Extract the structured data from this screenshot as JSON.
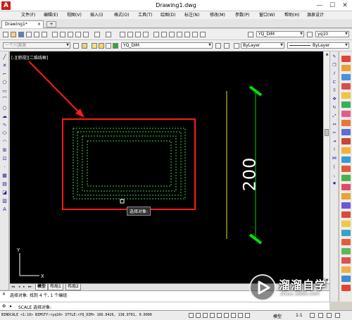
{
  "window": {
    "title": "Drawing1.dwg",
    "logo_letter": "A",
    "minimize": "—",
    "maximize": "☐",
    "close": "✕"
  },
  "menu": [
    "文件(F)",
    "编辑(E)",
    "视图(V)",
    "插入(I)",
    "格式(O)",
    "工具(T)",
    "绘图(D)",
    "标注(N)",
    "修改(M)",
    "参数(P)",
    "窗口(W)",
    "帮助(H)",
    "源泉设计"
  ],
  "document_tab": {
    "label": "Drawing1*",
    "close": "×",
    "new_tab": "+"
  },
  "toolbar1": {
    "dimstyle_combo": "YQ_DIM",
    "textstyle_combo": "yq10"
  },
  "toolbar2": {
    "workspace_combo": "一个川源源",
    "layer_combo": "YQ_DIM",
    "color_combo": "ByLayer",
    "linetype_combo": "ByLayer"
  },
  "canvas": {
    "viewport_label": "[-][俯视][二维线框]",
    "tooltip": "选择对象:",
    "dimension_value": "200",
    "background": "#000000",
    "highlight_color": "#ff1a1a",
    "dimension_color": "#00d000"
  },
  "layout_tabs": {
    "nav": [
      "◂◂",
      "◂",
      "▸",
      "▸▸"
    ],
    "tabs": [
      "模型",
      "布局1",
      "布局2"
    ],
    "active": "模型"
  },
  "command": {
    "history": "选择对象: 找到 4 个, 1 个编组",
    "prompt": "SCALE 选择对象:"
  },
  "status": {
    "readout": "BINDCALE <1:10> BIMSTY:<yq10> STYLE:<YQ_DIM>  166.0426, 138.9701, 0.0000",
    "model_label": "模型",
    "scale_label": "1:1"
  },
  "watermark": {
    "title": "溜溜自学",
    "url": "zixue.3d66.com"
  }
}
